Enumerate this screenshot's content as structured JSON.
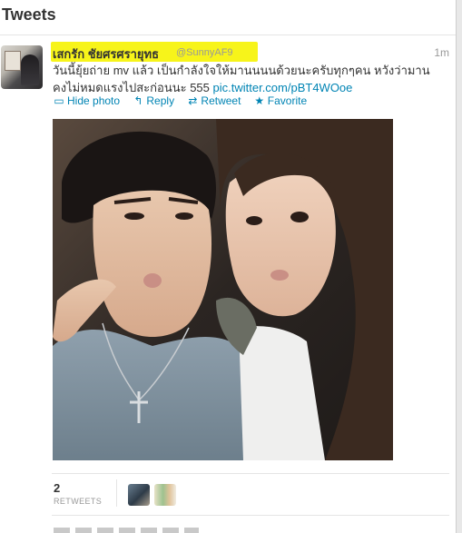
{
  "header": {
    "title": "Tweets"
  },
  "tweet": {
    "author_name": "เสกรัก ชัยศรศรายุทธ",
    "handle": "@SunnyAF9",
    "time": "1m",
    "text": "วันนี้ยุ้ยถ่าย mv แล้ว เป็นกำลังใจให้มานนนนด้วยนะครับทุกๆคน หวังว่ามานคงไม่หมดแรงไปสะก่อนนะ 555",
    "link": "pic.twitter.com/pBT4WOoe",
    "actions": {
      "hide_photo": "Hide photo",
      "reply": "Reply",
      "retweet": "Retweet",
      "favorite": "Favorite"
    },
    "retweet_count": "2",
    "retweet_label": "RETWEETS"
  },
  "colors": {
    "link": "#0084b4",
    "highlight": "#f7f41a",
    "text": "#333333",
    "muted": "#999999"
  },
  "icons": {
    "hide_photo": "photo-icon",
    "reply": "reply-arrow-icon",
    "retweet": "retweet-icon",
    "favorite": "star-icon"
  }
}
